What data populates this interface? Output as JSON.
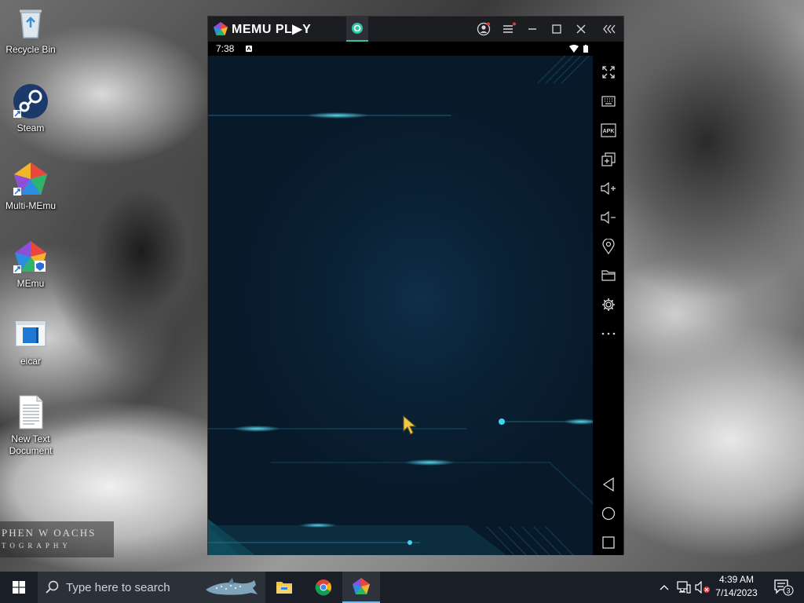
{
  "desktop": {
    "icons": [
      {
        "label": "Recycle Bin",
        "icon": "recycle-bin-icon"
      },
      {
        "label": "Steam",
        "icon": "steam-icon"
      },
      {
        "label": "Multi-MEmu",
        "icon": "multi-memu-icon"
      },
      {
        "label": "MEmu",
        "icon": "memu-icon"
      },
      {
        "label": "eicar",
        "icon": "eicar-file-icon"
      },
      {
        "label": "New Text Document",
        "icon": "text-document-icon"
      }
    ],
    "watermark": {
      "line1": "PHEN W OACHS",
      "line2": "TOGRAPHY"
    }
  },
  "emulator": {
    "brand": "MEMU PL▶Y",
    "status_time": "7:38",
    "sidebar": [
      "fullscreen-icon",
      "keyboard-icon",
      "apk-icon",
      "multi-window-icon",
      "volume-up-icon",
      "volume-down-icon",
      "location-icon",
      "folder-icon",
      "settings-icon",
      "more-icon",
      "back-icon",
      "home-icon",
      "recents-icon"
    ],
    "apk_label": "APK",
    "accent": "#2ec4a4"
  },
  "taskbar": {
    "search_placeholder": "Type here to search",
    "time": "4:39 AM",
    "date": "7/14/2023",
    "notification_count": "3"
  }
}
